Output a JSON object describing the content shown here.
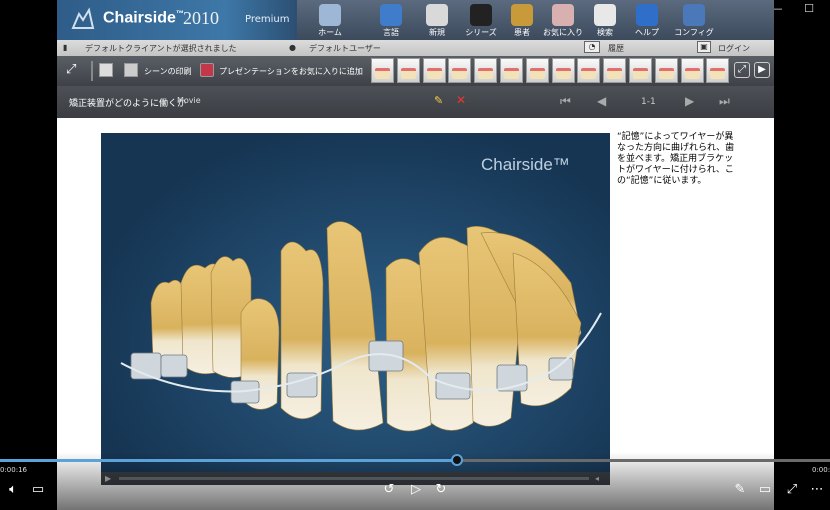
{
  "app": {
    "brand_name": "Chairside",
    "brand_tm": "™",
    "brand_year": "2010",
    "edition": "Premium"
  },
  "topnav": [
    {
      "label": "ホーム",
      "icon": "dental-chair-icon",
      "color": "#9fb7d6"
    },
    {
      "label": "言語",
      "icon": "language-icon",
      "color": "#3f7cc9"
    },
    {
      "label": "新規",
      "icon": "new-icon",
      "color": "#d9d9d9"
    },
    {
      "label": "シリーズ",
      "icon": "clapperboard-icon",
      "color": "#222222"
    },
    {
      "label": "患者",
      "icon": "patient-icon",
      "color": "#c89a3a"
    },
    {
      "label": "お気に入り",
      "icon": "favorites-icon",
      "color": "#d8b0b0"
    },
    {
      "label": "検索",
      "icon": "search-teeth-icon",
      "color": "#e8e8e8"
    },
    {
      "label": "ヘルプ",
      "icon": "help-icon",
      "color": "#2f6fc9"
    },
    {
      "label": "コンフィグ",
      "icon": "config-gear-icon",
      "color": "#4a78b8"
    }
  ],
  "userbar": {
    "client_status": "デフォルトクライアントが選択されました",
    "user": "デフォルトユーザー",
    "history": "履歴",
    "login": "ログイン"
  },
  "toolbar": {
    "print_label": "シーンの印刷",
    "favorite_label": "プレゼンテーションをお気に入りに追加"
  },
  "titlebar": {
    "title": "矯正装置がどのように働くか",
    "kind": "Movie",
    "page": "1-1"
  },
  "video": {
    "watermark": "Chairside™"
  },
  "description": "“記憶”によってワイヤーが異なった方向に曲げれられ、歯を並べます。矯正用ブラケットがワイヤーに付けられ、この“記憶”に従います。",
  "player": {
    "time_elapsed": "0:00:16",
    "time_remaining": "0:00:14",
    "progress": 0.55
  }
}
